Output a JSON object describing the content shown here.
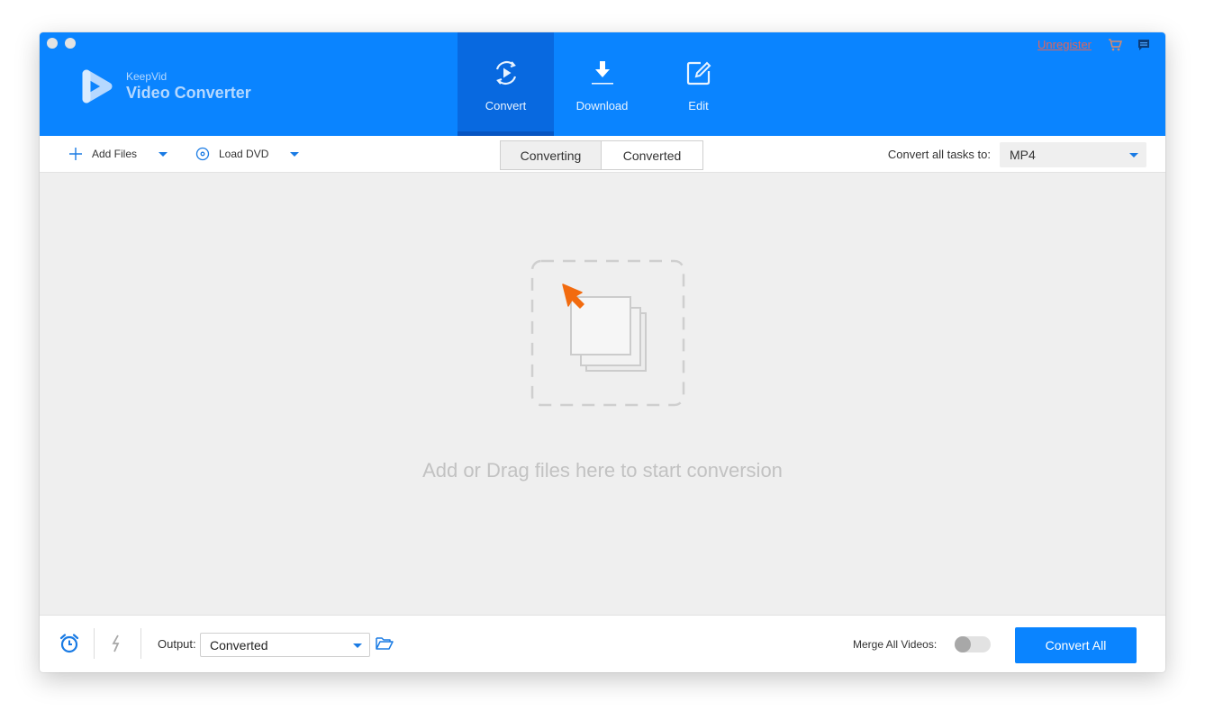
{
  "app": {
    "brand_small": "KeepVid",
    "brand_title": "Video Converter"
  },
  "nav": {
    "items": [
      {
        "label": "Convert",
        "icon": "convert-icon",
        "active": true
      },
      {
        "label": "Download",
        "icon": "download-icon",
        "active": false
      },
      {
        "label": "Edit",
        "icon": "edit-icon",
        "active": false
      }
    ]
  },
  "header_right": {
    "unregister": "Unregister",
    "cart_icon": "cart-icon",
    "feedback_icon": "chat-icon"
  },
  "toolbar": {
    "add_files": "Add Files",
    "load_dvd": "Load DVD",
    "tabs": [
      {
        "label": "Converting",
        "active": true
      },
      {
        "label": "Converted",
        "active": false
      }
    ],
    "convert_all_label": "Convert all tasks to:",
    "format_value": "MP4"
  },
  "main": {
    "drop_text": "Add or Drag files here to start conversion"
  },
  "footer": {
    "output_label": "Output:",
    "output_value": "Converted",
    "merge_label": "Merge All Videos:",
    "merge_enabled": false,
    "convert_all_button": "Convert All"
  },
  "colors": {
    "brand_blue": "#0A84FF",
    "active_tab_blue": "#0869E0",
    "cursor_orange": "#F26B0F",
    "unregister_red": "#E2645A"
  }
}
